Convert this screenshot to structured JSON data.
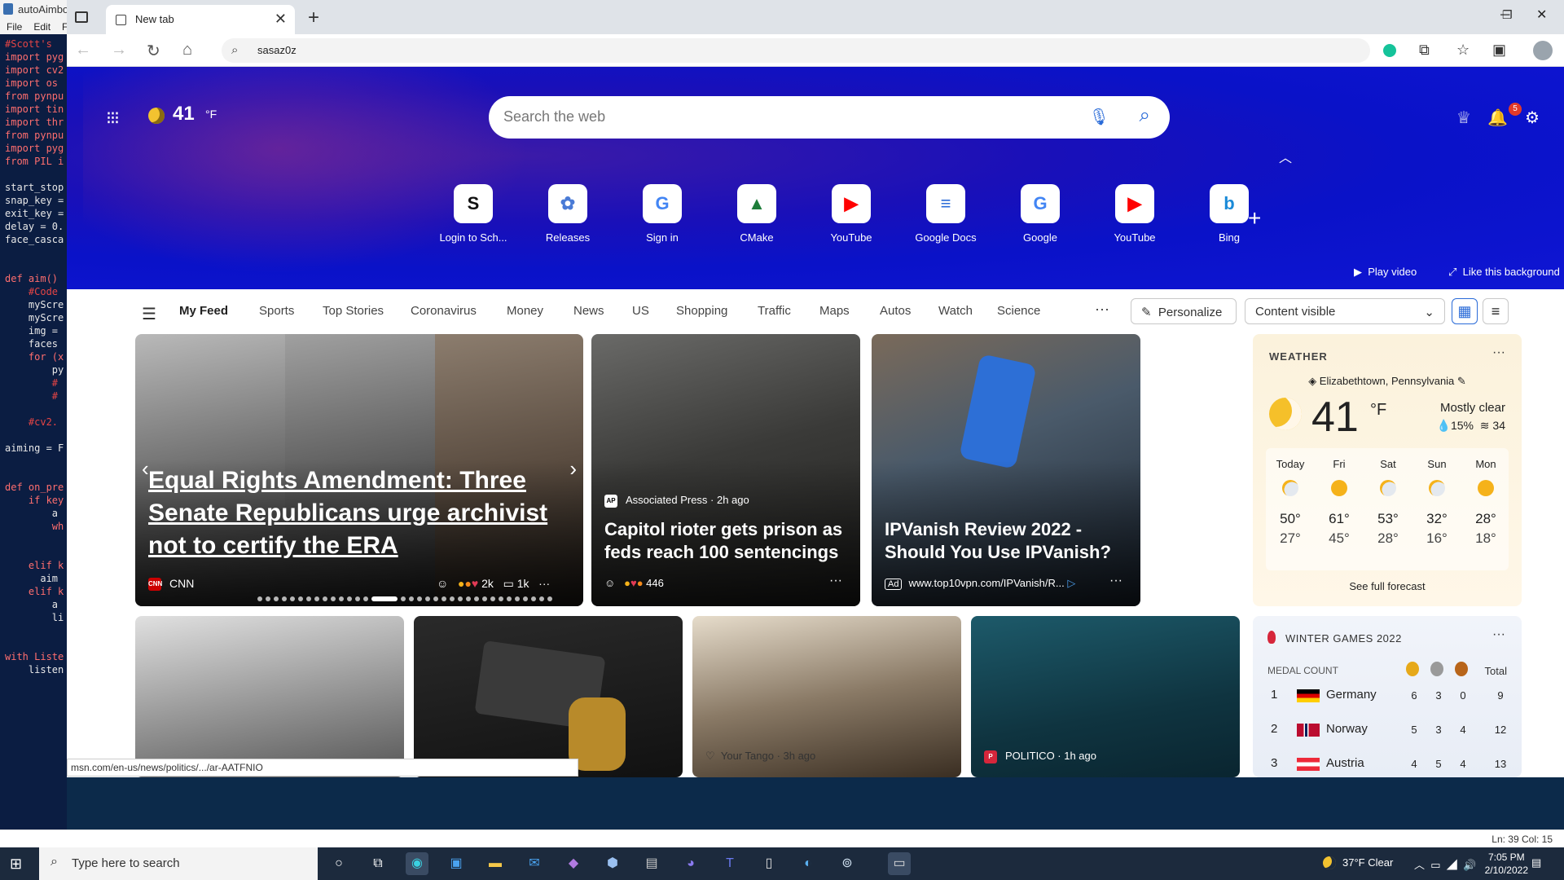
{
  "editor": {
    "title": "autoAimbot",
    "menu": [
      "File",
      "Edit",
      "F"
    ],
    "code_lines": [
      {
        "text": "#Scott's",
        "cls": "cm"
      },
      {
        "text": "import pyg",
        "cls": "kw"
      },
      {
        "text": "import cv2",
        "cls": "kw"
      },
      {
        "text": "import os",
        "cls": "kw"
      },
      {
        "text": "from pynpu",
        "cls": "kw"
      },
      {
        "text": "import tin",
        "cls": "kw"
      },
      {
        "text": "import thr",
        "cls": "kw"
      },
      {
        "text": "from pynpu",
        "cls": "kw"
      },
      {
        "text": "import pyg",
        "cls": "kw"
      },
      {
        "text": "from PIL i",
        "cls": "kw"
      },
      {
        "text": "",
        "cls": ""
      },
      {
        "text": "start_stop",
        "cls": ""
      },
      {
        "text": "snap_key =",
        "cls": ""
      },
      {
        "text": "exit_key =",
        "cls": ""
      },
      {
        "text": "delay = 0.",
        "cls": ""
      },
      {
        "text": "face_casca",
        "cls": ""
      },
      {
        "text": "",
        "cls": ""
      },
      {
        "text": "",
        "cls": ""
      },
      {
        "text": "def aim()",
        "cls": "kw"
      },
      {
        "text": "    #Code",
        "cls": "cm"
      },
      {
        "text": "    myScre",
        "cls": ""
      },
      {
        "text": "    myScre",
        "cls": ""
      },
      {
        "text": "    img =",
        "cls": ""
      },
      {
        "text": "    faces",
        "cls": ""
      },
      {
        "text": "    for (x",
        "cls": "kw"
      },
      {
        "text": "        py",
        "cls": ""
      },
      {
        "text": "        #",
        "cls": "cm"
      },
      {
        "text": "        #",
        "cls": "cm"
      },
      {
        "text": "",
        "cls": ""
      },
      {
        "text": "    #cv2.",
        "cls": "cm"
      },
      {
        "text": "",
        "cls": ""
      },
      {
        "text": "aiming = F",
        "cls": ""
      },
      {
        "text": "",
        "cls": ""
      },
      {
        "text": "",
        "cls": ""
      },
      {
        "text": "def on_pre",
        "cls": "kw"
      },
      {
        "text": "    if key",
        "cls": "kw"
      },
      {
        "text": "        a",
        "cls": ""
      },
      {
        "text": "        wh",
        "cls": "kw"
      },
      {
        "text": "",
        "cls": ""
      },
      {
        "text": "",
        "cls": ""
      },
      {
        "text": "    elif k",
        "cls": "kw"
      },
      {
        "text": "      aim",
        "cls": ""
      },
      {
        "text": "    elif k",
        "cls": "kw"
      },
      {
        "text": "        a",
        "cls": ""
      },
      {
        "text": "        li",
        "cls": ""
      },
      {
        "text": "",
        "cls": ""
      },
      {
        "text": "",
        "cls": ""
      },
      {
        "text": "with Liste",
        "cls": "kw"
      },
      {
        "text": "    listen",
        "cls": ""
      }
    ],
    "status": "Ln: 39   Col: 15"
  },
  "browser": {
    "tab_title": "New tab",
    "address": "sasaz0z",
    "status_url": "msn.com/en-us/news/politics/.../ar-AATFNIO"
  },
  "hero": {
    "temp": "41",
    "unit": "°F",
    "search_placeholder": "Search the web",
    "notification_count": "5",
    "quick_links": [
      {
        "label": "Login to Sch...",
        "glyph": "S",
        "color": "#111111"
      },
      {
        "label": "Releases",
        "glyph": "✿",
        "color": "#4a7bd6"
      },
      {
        "label": "Sign in",
        "glyph": "G",
        "color": "#4285f4"
      },
      {
        "label": "CMake",
        "glyph": "▲",
        "color": "#1e7d3a"
      },
      {
        "label": "YouTube",
        "glyph": "▶",
        "color": "#ff0000"
      },
      {
        "label": "Google Docs",
        "glyph": "≡",
        "color": "#2a6bd8"
      },
      {
        "label": "Google",
        "glyph": "G",
        "color": "#4285f4"
      },
      {
        "label": "YouTube",
        "glyph": "▶",
        "color": "#ff0000"
      },
      {
        "label": "Bing",
        "glyph": "b",
        "color": "#1a8ad8"
      }
    ],
    "play_video": "Play video",
    "like_background": "Like this background"
  },
  "nav": {
    "items": [
      "My Feed",
      "Sports",
      "Top Stories",
      "Coronavirus",
      "Money",
      "News",
      "US",
      "Shopping",
      "Traffic",
      "Maps",
      "Autos",
      "Watch",
      "Science"
    ],
    "personalize": "Personalize",
    "content_visible": "Content visible"
  },
  "cards": {
    "hero": {
      "title": "Equal Rights Amendment: Three Senate Republicans urge archivist not to certify the ERA",
      "source": "CNN",
      "reactions": "2k",
      "comments": "1k"
    },
    "capitol": {
      "source": "Associated Press · 2h ago",
      "title": "Capitol rioter gets prison as feds reach 100 sentencings",
      "reactions": "446"
    },
    "ipvanish": {
      "title": "IPVanish Review 2022 - Should You Use IPVanish?",
      "ad": "Ad",
      "url": "www.top10vpn.com/IPVanish/R..."
    },
    "row2_tango": "Your Tango · 3h ago",
    "row2_politico": "POLITICO · 1h ago"
  },
  "weather": {
    "heading": "WEATHER",
    "location": "Elizabethtown, Pennsylvania",
    "temp": "41",
    "unit": "°F",
    "condition": "Mostly clear",
    "precip": "15%",
    "aqi": "34",
    "forecast": [
      {
        "day": "Today",
        "hi": "50°",
        "lo": "27°",
        "icon": "cloudy"
      },
      {
        "day": "Fri",
        "hi": "61°",
        "lo": "45°",
        "icon": "sunny"
      },
      {
        "day": "Sat",
        "hi": "53°",
        "lo": "28°",
        "icon": "cloudy"
      },
      {
        "day": "Sun",
        "hi": "32°",
        "lo": "16°",
        "icon": "cloudy"
      },
      {
        "day": "Mon",
        "hi": "28°",
        "lo": "18°",
        "icon": "sunny"
      }
    ],
    "full_forecast": "See full forecast"
  },
  "medals": {
    "heading": "WINTER GAMES 2022",
    "subheading": "MEDAL COUNT",
    "total_label": "Total",
    "rows": [
      {
        "rank": "1",
        "country": "Germany",
        "gold": "6",
        "silver": "3",
        "bronze": "0",
        "total": "9"
      },
      {
        "rank": "2",
        "country": "Norway",
        "gold": "5",
        "silver": "3",
        "bronze": "4",
        "total": "12"
      },
      {
        "rank": "3",
        "country": "Austria",
        "gold": "4",
        "silver": "5",
        "bronze": "4",
        "total": "13"
      }
    ]
  },
  "taskbar": {
    "search_placeholder": "Type here to search",
    "weather": "37°F  Clear",
    "time": "7:05 PM",
    "date": "2/10/2022"
  }
}
